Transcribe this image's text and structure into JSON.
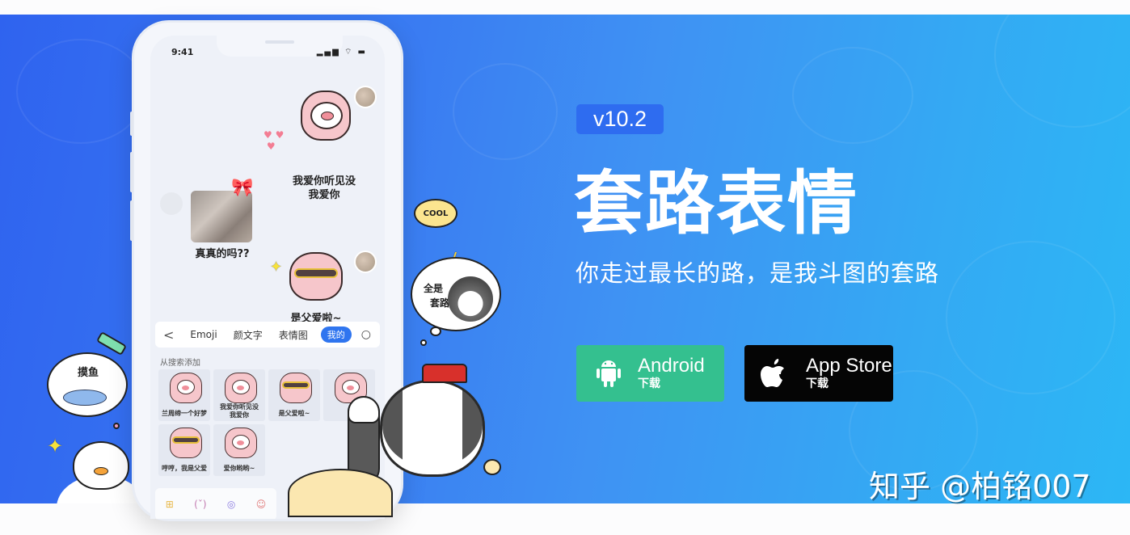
{
  "banner": {
    "version": "v10.2",
    "headline": "套路表情",
    "subtitle": "你走过最长的路，是我斗图的套路",
    "colors": {
      "gradient_start": "#2f63ef",
      "gradient_end": "#2cb7f5",
      "badge": "#2e6cf0",
      "android": "#34c08f",
      "apple": "#050505"
    }
  },
  "downloads": [
    {
      "platform": "Android",
      "label": "Android",
      "sublabel": "下载",
      "icon": "android-icon"
    },
    {
      "platform": "iOS",
      "label": "App Store",
      "sublabel": "下载",
      "icon": "apple-icon"
    }
  ],
  "watermark": "知乎 @柏铭007",
  "phone": {
    "status_time": "9:41",
    "status_icons": "signal wifi battery",
    "chat": [
      {
        "side": "right",
        "caption_lines": [
          "我爱你听见没",
          "我爱你"
        ],
        "sticker": "pig-hearts"
      },
      {
        "side": "left",
        "caption_lines": [
          "真真的吗??"
        ],
        "sticker": "cat-photo"
      },
      {
        "side": "right",
        "caption_lines": [
          "是父爱啦~"
        ],
        "sticker": "pig-sunglasses"
      }
    ],
    "tabs": [
      {
        "label": "<",
        "icon": "back-icon"
      },
      {
        "label": "Emoji"
      },
      {
        "label": "颜文字"
      },
      {
        "label": "表情图"
      },
      {
        "label": "我的",
        "active": true
      },
      {
        "label": "○",
        "icon": "search-icon"
      }
    ],
    "section_label": "从搜索添加",
    "sticker_grid": [
      {
        "caption": "兰周缔一个好梦"
      },
      {
        "caption": "我爱你听见没\n我爱你"
      },
      {
        "caption": "是父爱啦~"
      },
      {
        "caption": ""
      },
      {
        "caption": "哼哼，我是父爱"
      },
      {
        "caption": "爱你哟哟~"
      }
    ],
    "bottom_icons": [
      "sticker-pack-icon",
      "kaomoji-icon",
      "camera-icon",
      "pig-icon"
    ],
    "bottom_labels": [
      "⊞",
      "(ˇ)",
      "◎",
      "☺"
    ]
  },
  "decorations": {
    "cool_bubble": "COOL",
    "think_bubble": [
      "全是",
      "套路"
    ],
    "fish_bubble": "摸鱼"
  }
}
